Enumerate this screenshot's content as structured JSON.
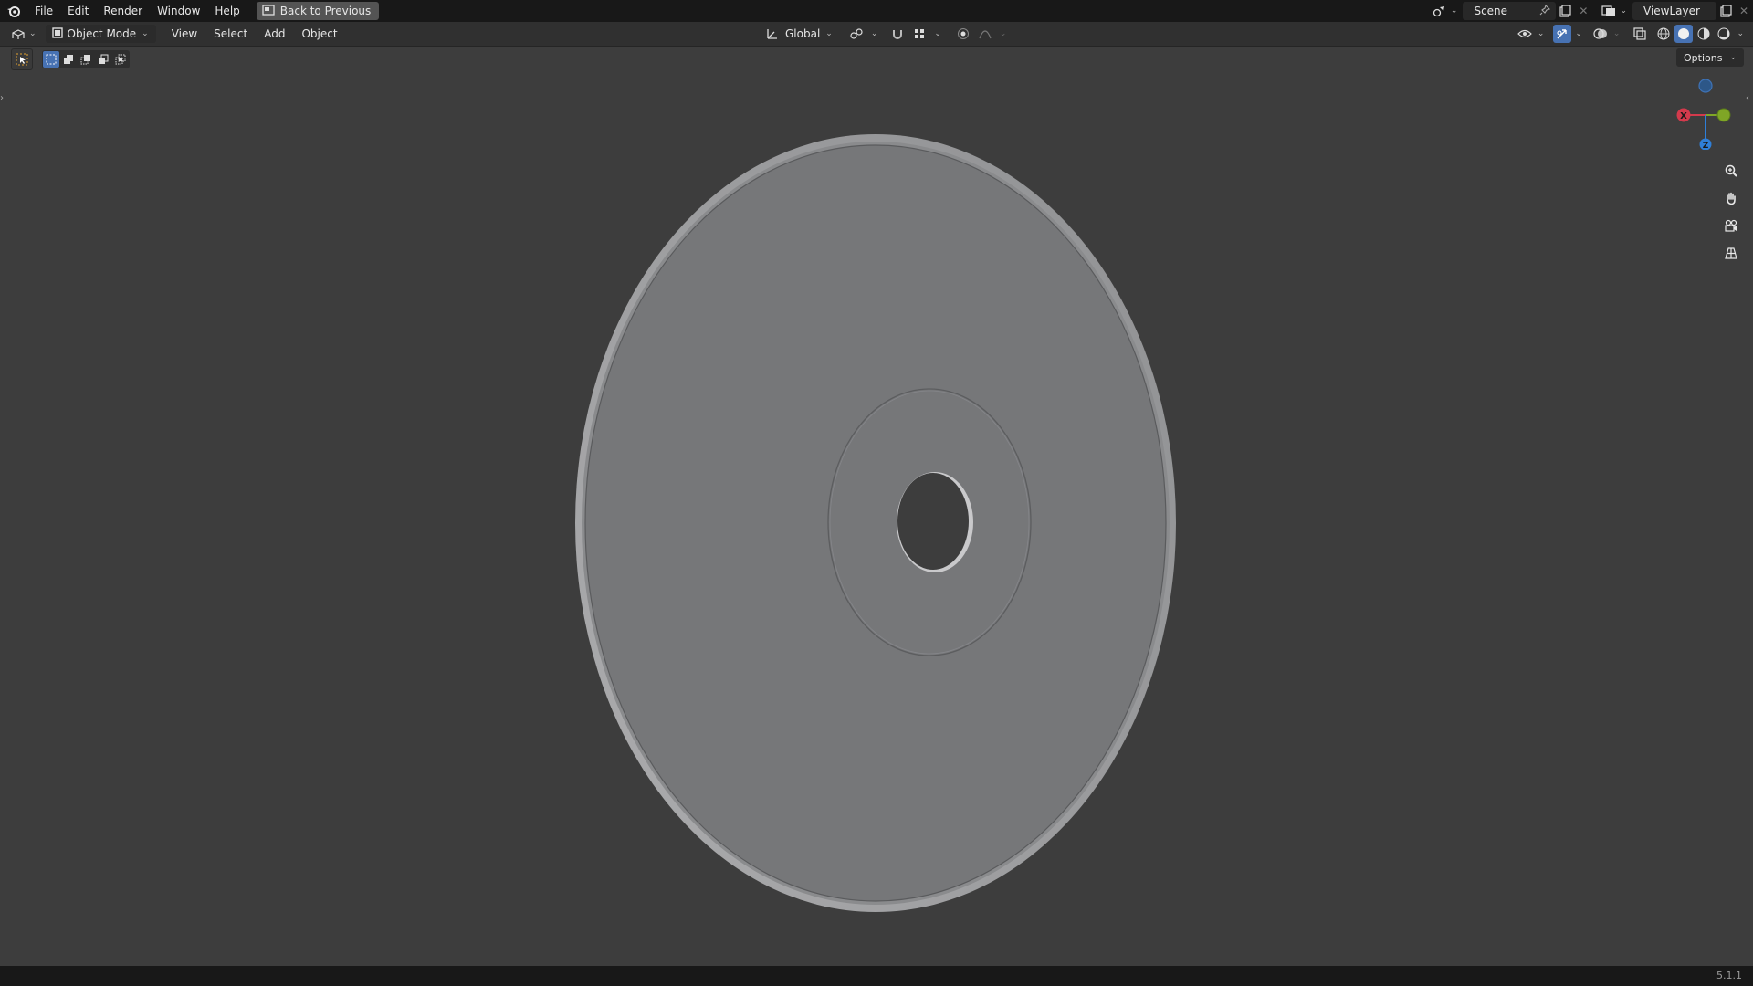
{
  "topbar": {
    "menu": [
      "File",
      "Edit",
      "Render",
      "Window",
      "Help"
    ],
    "back_button": "Back to Previous",
    "scene": "Scene",
    "view_layer": "ViewLayer"
  },
  "header": {
    "mode": "Object Mode",
    "menus": [
      "View",
      "Select",
      "Add",
      "Object"
    ],
    "transform_orientation": "Global"
  },
  "viewport": {
    "options_label": "Options",
    "axes": {
      "x": "X",
      "z": "Z"
    }
  },
  "status": {
    "version": "5.1.1"
  },
  "colors": {
    "accent": "#4772b3",
    "axis_x": "#d33a4c",
    "axis_y": "#7fa626",
    "axis_z": "#2f7fd8",
    "object_face": "#767779",
    "background": "#3d3d3d"
  },
  "icons": {
    "logo": "blender-logo-icon",
    "workspace": "restore-icon",
    "editor_type": "3d-viewport-icon",
    "mode": "object-cube-icon",
    "transform": "transform-orientation-icon",
    "pivot": "pivot-icon",
    "snap": "snap-magnet-icon",
    "proportional": "proportional-edit-icon",
    "zoom": "zoom-icon",
    "pan": "hand-icon",
    "camera": "camera-icon",
    "ortho": "grid-icon"
  }
}
